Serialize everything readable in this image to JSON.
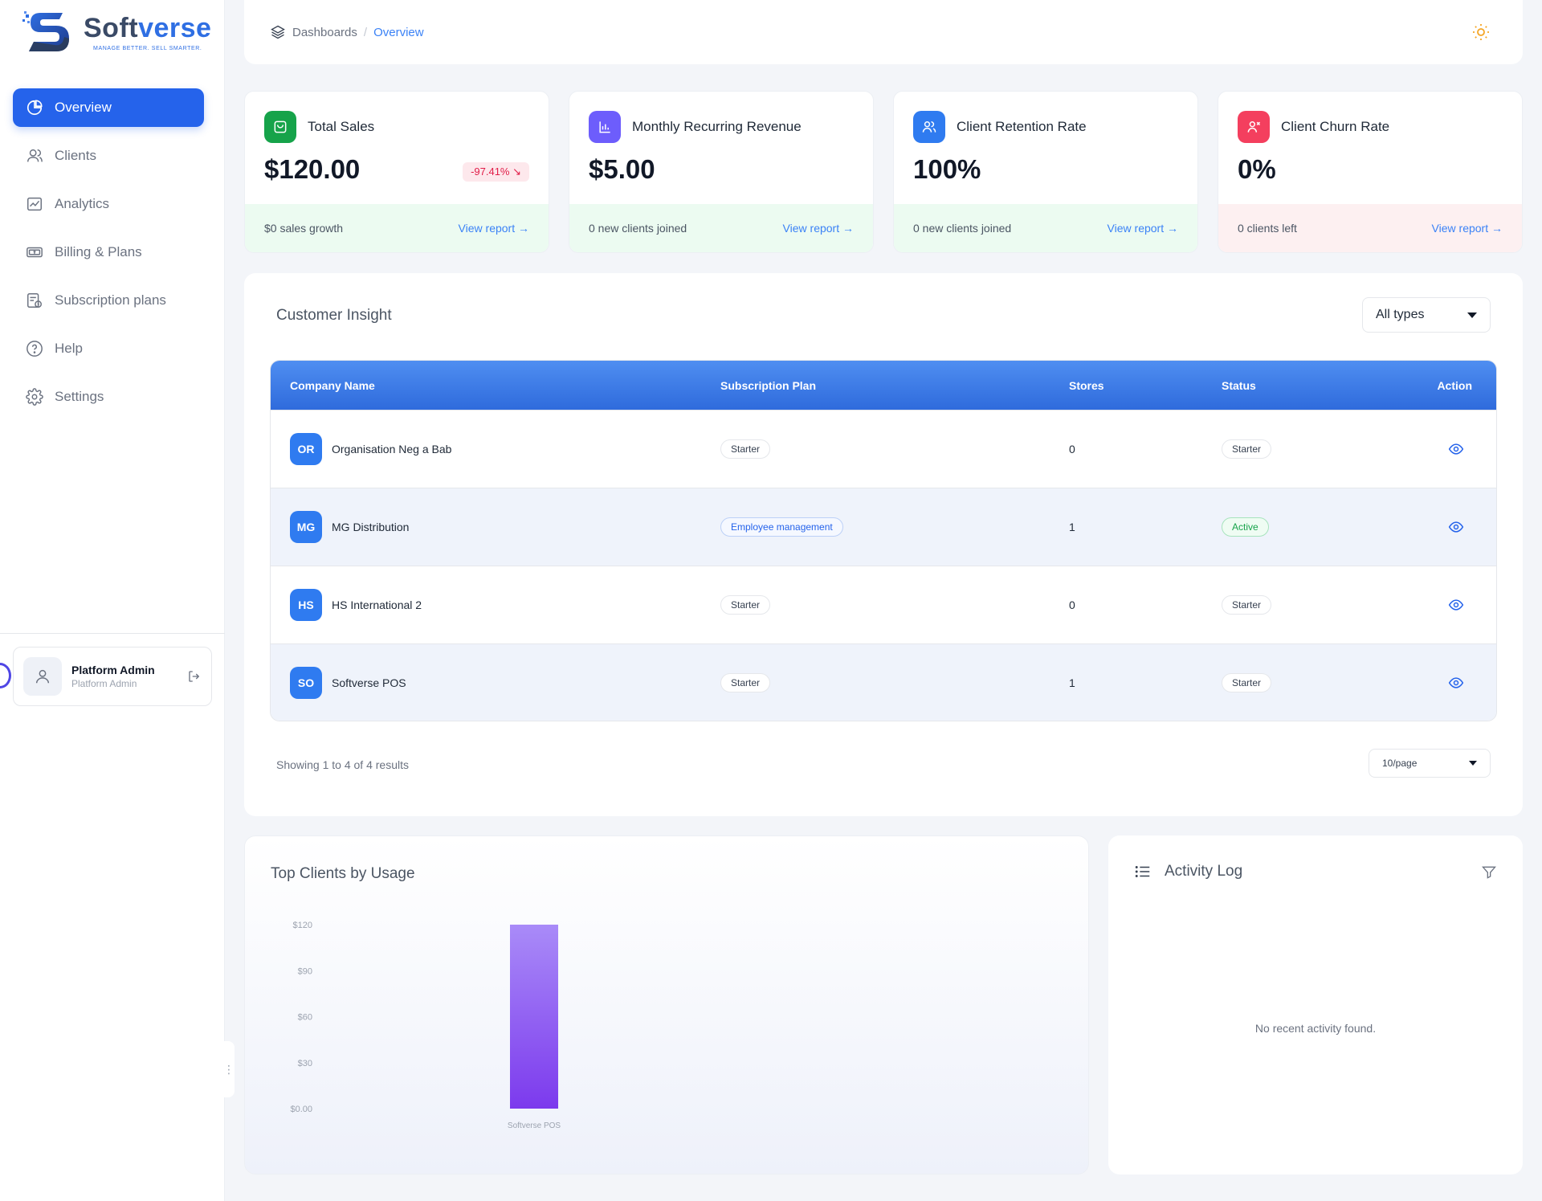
{
  "brand": {
    "name_a": "Soft",
    "name_b": "verse",
    "tagline": "MANAGE BETTER. SELL SMARTER."
  },
  "sidebar": {
    "items": [
      {
        "label": "Overview",
        "icon": "pie-chart-icon",
        "active": true
      },
      {
        "label": "Clients",
        "icon": "users-icon"
      },
      {
        "label": "Analytics",
        "icon": "analytics-icon"
      },
      {
        "label": "Billing & Plans",
        "icon": "billing-icon"
      },
      {
        "label": "Subscription plans",
        "icon": "subscription-icon"
      },
      {
        "label": "Help",
        "icon": "help-icon"
      },
      {
        "label": "Settings",
        "icon": "gear-icon"
      }
    ],
    "user": {
      "name": "Platform Admin",
      "role": "Platform Admin"
    }
  },
  "header": {
    "breadcrumb": [
      "Dashboards",
      "Overview"
    ]
  },
  "stats": [
    {
      "title": "Total Sales",
      "value": "$120.00",
      "badge": "-97.41% ↘",
      "footer": "$0 sales growth",
      "link": "View report →",
      "icon_color": "#16a34a",
      "tone": "green"
    },
    {
      "title": "Monthly Recurring Revenue",
      "value": "$5.00",
      "footer": "0 new clients joined",
      "link": "View report →",
      "icon_color": "#6d5dfc",
      "tone": "green"
    },
    {
      "title": "Client Retention Rate",
      "value": "100%",
      "footer": "0 new clients joined",
      "link": "View report →",
      "icon_color": "#2f7bf0",
      "tone": "green"
    },
    {
      "title": "Client Churn Rate",
      "value": "0%",
      "footer": "0 clients left",
      "link": "View report →",
      "icon_color": "#f43f5e",
      "tone": "red"
    }
  ],
  "insight": {
    "title": "Customer Insight",
    "filter": "All types",
    "columns": [
      "Company Name",
      "Subscription Plan",
      "Stores",
      "Status",
      "Action"
    ],
    "rows": [
      {
        "initials": "OR",
        "company": "Organisation Neg a Bab",
        "plan": "Starter",
        "plan_style": "plain",
        "stores": "0",
        "status": "Starter",
        "status_style": "plain"
      },
      {
        "initials": "MG",
        "company": "MG Distribution",
        "plan": "Employee management",
        "plan_style": "blue",
        "stores": "1",
        "status": "Active",
        "status_style": "green"
      },
      {
        "initials": "HS",
        "company": "HS International 2",
        "plan": "Starter",
        "plan_style": "plain",
        "stores": "0",
        "status": "Starter",
        "status_style": "plain"
      },
      {
        "initials": "SO",
        "company": "Softverse POS",
        "plan": "Starter",
        "plan_style": "plain",
        "stores": "1",
        "status": "Starter",
        "status_style": "plain"
      }
    ],
    "showing": "Showing 1 to 4 of 4 results",
    "page_size": "10/page"
  },
  "chart_data": {
    "type": "bar",
    "title": "Top Clients by Usage",
    "categories": [
      "Softverse POS"
    ],
    "values": [
      120
    ],
    "ylim": [
      0,
      120
    ],
    "yticks": [
      "$0.00",
      "$30",
      "$60",
      "$90",
      "$120"
    ],
    "ytick_values": [
      0,
      30,
      60,
      90,
      120
    ],
    "bar_color_top": "#a98bf8",
    "bar_color_bottom": "#7c3aed",
    "grid": false
  },
  "activity": {
    "title": "Activity Log",
    "empty": "No recent activity found."
  },
  "colors": {
    "accent": "#2563eb",
    "theme_icon": "#f5a524"
  }
}
